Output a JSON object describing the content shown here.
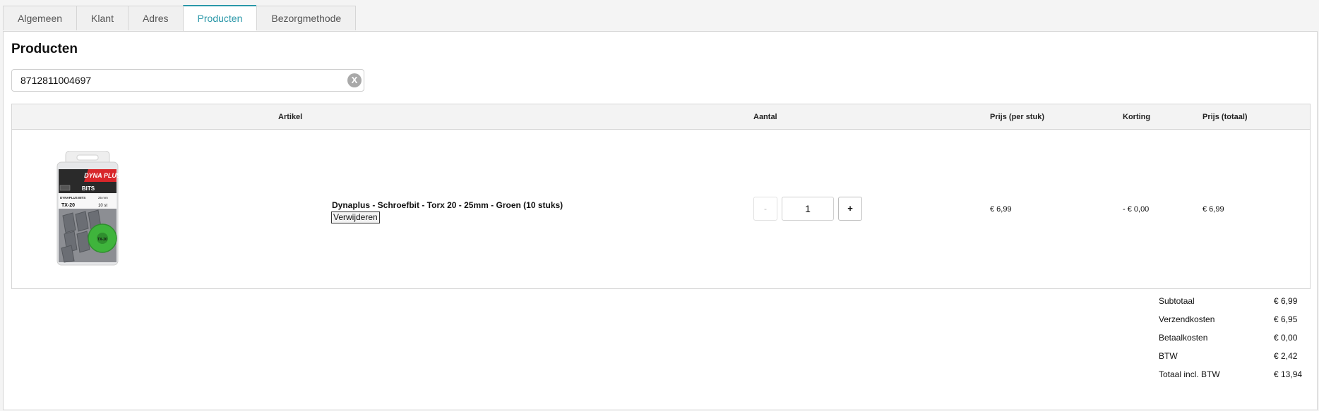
{
  "tabs": [
    "Algemeen",
    "Klant",
    "Adres",
    "Producten",
    "Bezorgmethode"
  ],
  "active_tab": "Producten",
  "page_title": "Producten",
  "search": {
    "value": "8712811004697",
    "clear_label": "X"
  },
  "table": {
    "headers": {
      "artikel": "Artikel",
      "aantal": "Aantal",
      "prijs_stuk": "Prijs (per stuk)",
      "korting": "Korting",
      "prijs_totaal": "Prijs (totaal)"
    },
    "rows": [
      {
        "name": "Dynaplus - Schroefbit - Torx 20 - 25mm - Groen (10 stuks)",
        "remove_label": "Verwijderen",
        "qty_minus": "-",
        "qty": "1",
        "qty_plus": "+",
        "price_each": "€ 6,99",
        "discount": "- € 0,00",
        "price_total": "€ 6,99",
        "image": {
          "brand": "DYNA PLUS",
          "type": "BITS",
          "line": "DYNAPLUS BITS",
          "size": "25 mm",
          "code": "TX-20",
          "count": "10 st",
          "disc": "TX-20"
        }
      }
    ]
  },
  "totals": [
    {
      "label": "Subtotaal",
      "value": "€ 6,99"
    },
    {
      "label": "Verzendkosten",
      "value": "€ 6,95"
    },
    {
      "label": "Betaalkosten",
      "value": "€ 0,00"
    },
    {
      "label": "BTW",
      "value": "€ 2,42"
    },
    {
      "label": "Totaal incl. BTW",
      "value": "€ 13,94"
    }
  ],
  "colors": {
    "accent": "#2a97a8",
    "accent_green": "#3fb43c"
  }
}
